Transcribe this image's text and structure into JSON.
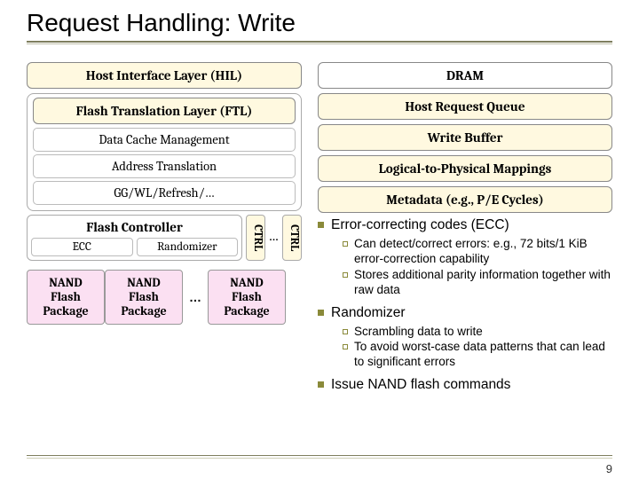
{
  "title": "Request Handling: Write",
  "left": {
    "hil": "Host Interface Layer (HIL)",
    "ftl": "Flash Translation Layer (FTL)",
    "dcm": "Data Cache Management",
    "addr": "Address Translation",
    "gg": "GG/WL/Refresh/…",
    "fc_title": "Flash Controller",
    "ecc": "ECC",
    "rand": "Randomizer",
    "ctrl": "CTRL",
    "nand": "NAND\nFlash\nPackage",
    "dots": "…"
  },
  "right": {
    "dram": "DRAM",
    "hrq": "Host Request Queue",
    "wb": "Write Buffer",
    "l2p": "Logical-to-Physical Mappings",
    "meta": "Metadata (e.g., P/E Cycles)"
  },
  "bullets": {
    "ecc_title": "Error-correcting codes (ECC)",
    "ecc_a": "Can detect/correct errors: e.g., 72 bits/1 KiB error-correction capability",
    "ecc_b": "Stores additional parity information together with raw data",
    "rand_title": "Randomizer",
    "rand_a": "Scrambling data to write",
    "rand_b": "To avoid worst-case data patterns that can lead to significant errors",
    "issue": "Issue NAND flash commands"
  },
  "page": "9"
}
